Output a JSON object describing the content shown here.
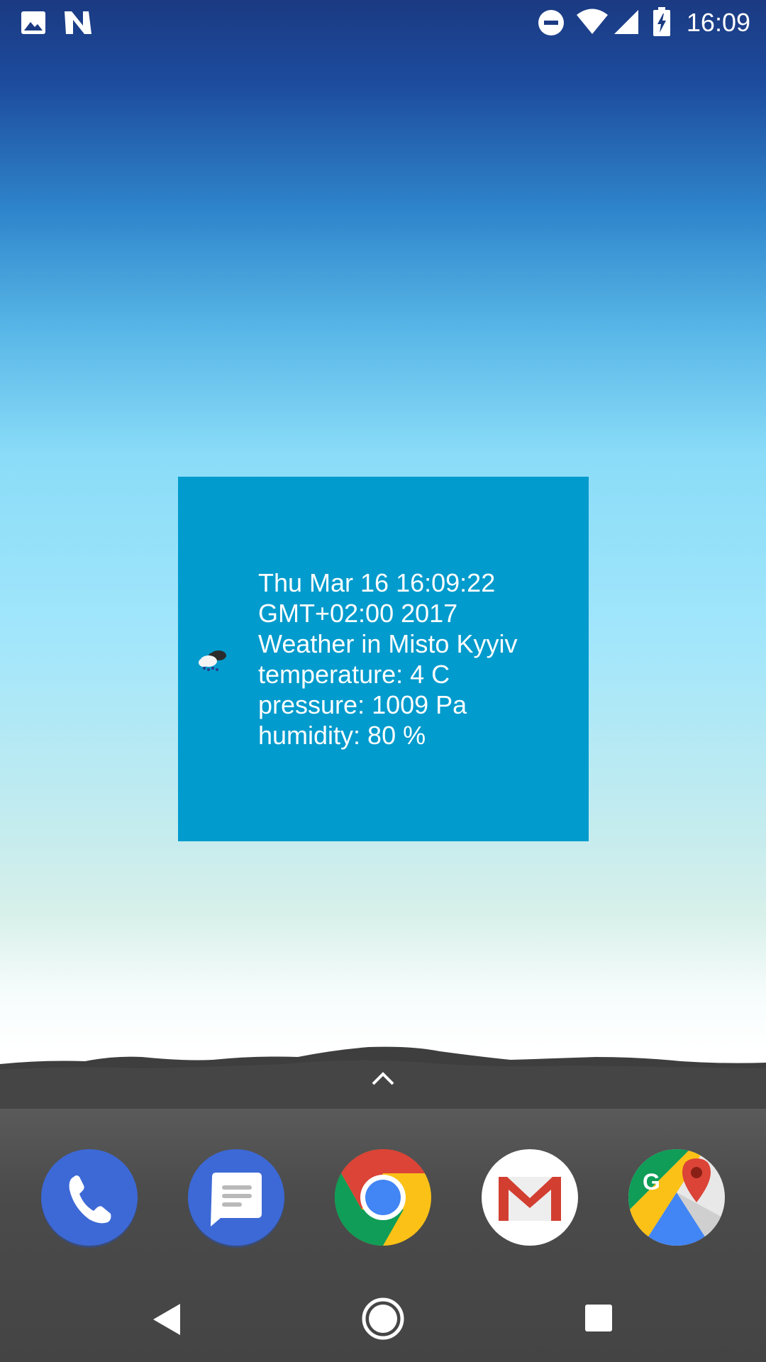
{
  "status_bar": {
    "time": "16:09",
    "icons": [
      "gallery-notification-icon",
      "n-notification-icon",
      "do-not-disturb-icon",
      "wifi-icon",
      "cell-signal-icon",
      "battery-charging-icon"
    ]
  },
  "weather_widget": {
    "icon": "snow-cloud-icon",
    "background_color": "#019bcd",
    "date_line1": "Thu Mar 16 16:09:22",
    "date_line2": "GMT+02:00 2017",
    "location": "Weather in Misto Kyyiv",
    "temperature": "temperature: 4 C",
    "pressure": "pressure: 1009 Pa",
    "humidity": "humidity: 80 %"
  },
  "dock": {
    "apps": [
      {
        "name": "Phone",
        "icon": "phone-icon"
      },
      {
        "name": "Messages",
        "icon": "messages-icon"
      },
      {
        "name": "Chrome",
        "icon": "chrome-icon"
      },
      {
        "name": "Gmail",
        "icon": "gmail-icon"
      },
      {
        "name": "Maps",
        "icon": "maps-icon"
      }
    ]
  },
  "nav_bar": {
    "buttons": [
      "back-icon",
      "home-icon",
      "recents-icon"
    ]
  }
}
